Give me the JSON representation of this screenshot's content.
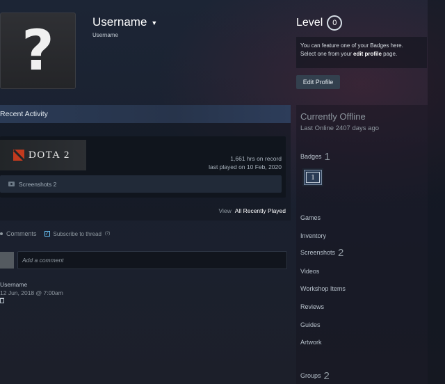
{
  "profile": {
    "username": "Username",
    "username_sub": "Username",
    "avatar_glyph": "?"
  },
  "level": {
    "label": "Level",
    "value": "0",
    "badge_notice_line1": "You can feature one of your Badges here.",
    "badge_notice_pre": "Select one from your ",
    "badge_notice_link": "edit profile",
    "badge_notice_post": " page.",
    "edit_button": "Edit Profile"
  },
  "activity": {
    "title": "Recent Activity",
    "game": {
      "name": "DOTA 2",
      "hours": "1,661 hrs on record",
      "last_played": "last played on 10 Feb, 2020",
      "screenshots": "Screenshots 2"
    },
    "view_label": "View",
    "all_played": "All Recently Played"
  },
  "comments": {
    "label": "Comments",
    "subscribe": "Subscribe to thread",
    "subscribe_count": "(?)",
    "placeholder": "Add a comment",
    "entry": {
      "user": "Username",
      "date": "12 Jun, 2018 @ 7:00am"
    }
  },
  "status": {
    "offline": "Currently Offline",
    "last_online": "Last Online 2407 days ago"
  },
  "sidebar": {
    "badges_label": "Badges",
    "badges_count": "1",
    "badge_tile_value": "1",
    "links": [
      {
        "label": "Games",
        "count": ""
      },
      {
        "label": "Inventory",
        "count": ""
      },
      {
        "label": "Screenshots",
        "count": "2"
      },
      {
        "label": "Videos",
        "count": ""
      },
      {
        "label": "Workshop Items",
        "count": ""
      },
      {
        "label": "Reviews",
        "count": ""
      },
      {
        "label": "Guides",
        "count": ""
      },
      {
        "label": "Artwork",
        "count": ""
      }
    ],
    "groups_label": "Groups",
    "groups_count": "2"
  },
  "colors": {
    "background": "#1b2232",
    "link_accent": "#67c1f5",
    "dota_red": "#c23a1e"
  }
}
